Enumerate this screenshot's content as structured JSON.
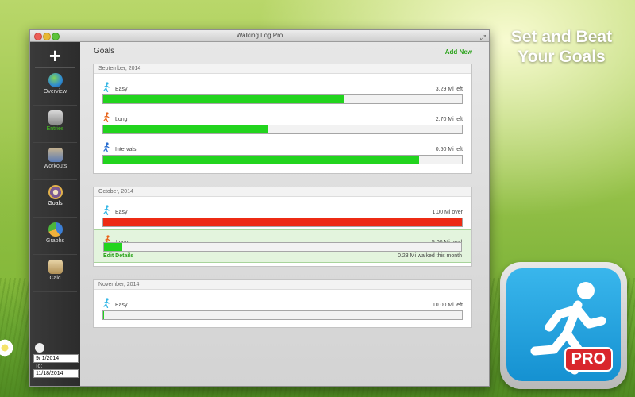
{
  "tagline": {
    "line1": "Set and Beat",
    "line2": "Your Goals"
  },
  "app_icon": {
    "badge": "PRO",
    "icon": "running-man-icon"
  },
  "window": {
    "title": "Walking Log Pro"
  },
  "sidebar": {
    "add_icon": "plus-icon",
    "items": [
      {
        "label": "Overview",
        "icon": "globe-icon"
      },
      {
        "label": "Entries",
        "icon": "notebook-icon",
        "active": true
      },
      {
        "label": "Workouts",
        "icon": "strongman-icon"
      },
      {
        "label": "Goals",
        "icon": "target-icon"
      },
      {
        "label": "Graphs",
        "icon": "pie-chart-icon"
      },
      {
        "label": "Calc",
        "icon": "calculator-icon"
      }
    ],
    "from_date": "9/ 1/2014",
    "to_label": "To:",
    "to_date": "11/18/2014"
  },
  "main": {
    "title": "Goals",
    "add_new": "Add New"
  },
  "colors": {
    "progress_ok": "#22d41e",
    "progress_over": "#ed2b14",
    "accent": "#2aa21a"
  },
  "groups": [
    {
      "month": "September, 2014",
      "goals": [
        {
          "name": "Easy",
          "status": "3.29 Mi left",
          "progress": 0.67,
          "runner": "cyan"
        },
        {
          "name": "Long",
          "status": "2.70 Mi left",
          "progress": 0.46,
          "runner": "orange"
        },
        {
          "name": "Intervals",
          "status": "0.50 Mi left",
          "progress": 0.88,
          "runner": "blue"
        }
      ]
    },
    {
      "month": "October, 2014",
      "goals": [
        {
          "name": "Easy",
          "status": "1.00 Mi over",
          "progress": 1.0,
          "runner": "cyan",
          "over": true
        },
        {
          "name": "Long",
          "status": "5.00 Mi goal",
          "progress": 0.05,
          "runner": "orange",
          "selected": true,
          "edit": "Edit Details",
          "walked": "0.23 Mi walked this month"
        }
      ]
    },
    {
      "month": "November, 2014",
      "goals": [
        {
          "name": "Easy",
          "status": "10.00 Mi left",
          "progress": 0.0,
          "runner": "cyan"
        }
      ]
    }
  ]
}
